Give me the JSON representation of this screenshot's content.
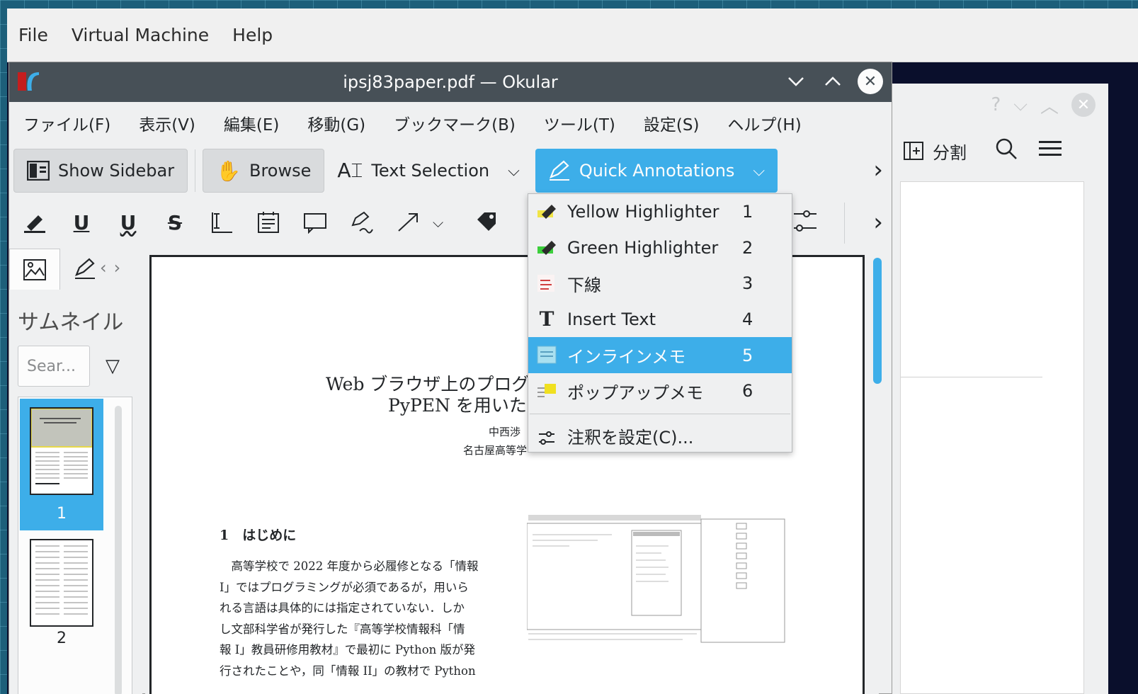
{
  "vm": {
    "menu": [
      "File",
      "Virtual Machine",
      "Help"
    ]
  },
  "bg_window": {
    "split_label": "分割",
    "help_glyph": "?"
  },
  "window": {
    "title": "ipsj83paper.pdf — Okular"
  },
  "menubar": [
    "ファイル(F)",
    "表示(V)",
    "編集(E)",
    "移動(G)",
    "ブックマーク(B)",
    "ツール(T)",
    "設定(S)",
    "ヘルプ(H)"
  ],
  "toolbar": {
    "show_sidebar": "Show Sidebar",
    "browse": "Browse",
    "text_selection": "Text Selection",
    "quick_annotations": "Quick Annotations"
  },
  "sidebar": {
    "title": "サムネイル",
    "search_placeholder": "Sear...",
    "pages": [
      "1",
      "2"
    ],
    "selected_page": "1"
  },
  "document": {
    "title_line1": "Web ブラウザ上のプログ",
    "title_line2": "PyPEN を用いた",
    "author_line1": "中西渉",
    "author_line2": "名古屋高等学",
    "section_heading": "1　はじめに",
    "body_lines": [
      "　高等学校で 2022 年度から必履修となる「情報",
      "I」ではプログラミングが必須であるが，用いら",
      "れる言語は具体的には指定されていない．しか",
      "し文部科学省が発行した『高等学校情報科「情",
      "報 I」教員研修用教材』で最初に Python 版が発",
      "行されたことや，同「情報 II」の教材で Python"
    ]
  },
  "quick_annotations_menu": {
    "items": [
      {
        "label": "Yellow Highlighter",
        "shortcut": "1",
        "icon": "yellow-highlighter-icon"
      },
      {
        "label": "Green Highlighter",
        "shortcut": "2",
        "icon": "green-highlighter-icon"
      },
      {
        "label": "下線",
        "shortcut": "3",
        "icon": "underline-annot-icon"
      },
      {
        "label": "Insert Text",
        "shortcut": "4",
        "icon": "insert-text-icon"
      },
      {
        "label": "インラインメモ",
        "shortcut": "5",
        "icon": "inline-note-icon"
      },
      {
        "label": "ポップアップメモ",
        "shortcut": "6",
        "icon": "popup-note-icon"
      }
    ],
    "highlighted_index": 4,
    "configure": "注釈を設定(C)..."
  },
  "colors": {
    "accent": "#3daee9",
    "titlebar": "#475057",
    "window_bg": "#eff0f1"
  }
}
